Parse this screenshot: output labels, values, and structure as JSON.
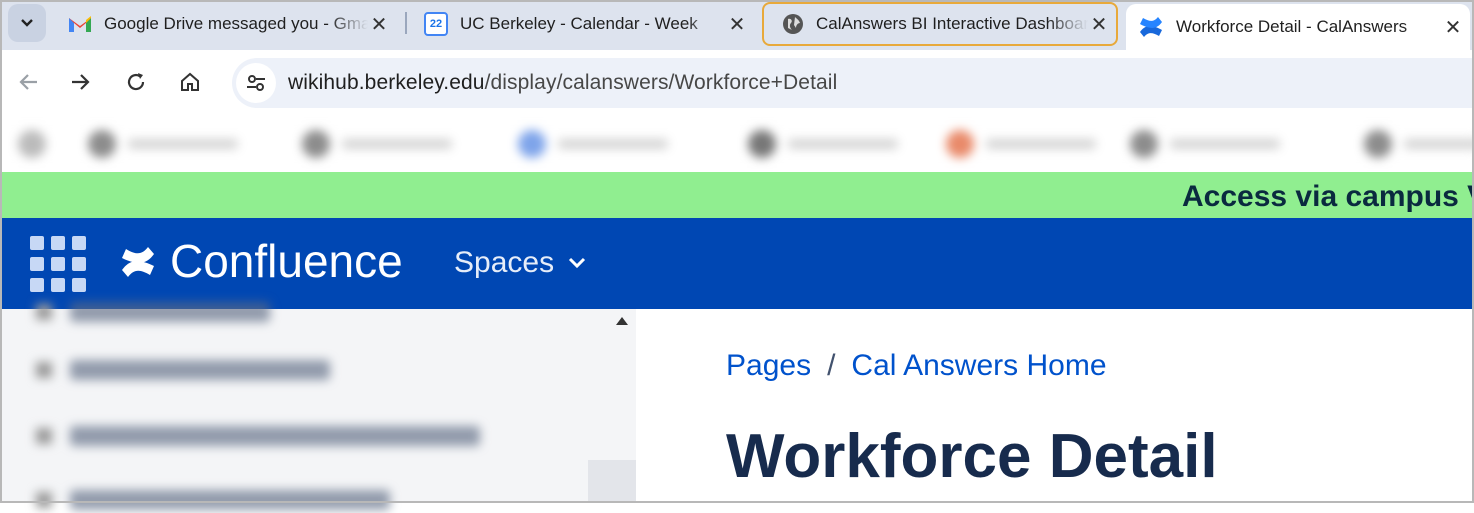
{
  "browser": {
    "tabs": [
      {
        "title": "Google Drive messaged you - Gmail",
        "icon": "gmail-icon"
      },
      {
        "title": "UC Berkeley - Calendar - Week",
        "icon": "google-calendar-icon",
        "badge": "22"
      },
      {
        "title": "CalAnswers BI Interactive Dashboards",
        "icon": "globe-icon"
      },
      {
        "title": "Workforce Detail - CalAnswers",
        "icon": "confluence-icon"
      }
    ],
    "url_host": "wikihub.berkeley.edu",
    "url_path": "/display/calanswers/Workforce+Detail"
  },
  "banner": {
    "text": "Access via campus V"
  },
  "header": {
    "product": "Confluence",
    "spaces_label": "Spaces"
  },
  "breadcrumbs": [
    {
      "label": "Pages"
    },
    {
      "label": "Cal Answers Home"
    }
  ],
  "breadcrumb_separator": "/",
  "page_title": "Workforce Detail",
  "colors": {
    "banner": "#90ee90",
    "header": "#0047b3",
    "link": "#0052cc",
    "title": "#172b4d",
    "tab_highlight": "#e8a93a"
  }
}
